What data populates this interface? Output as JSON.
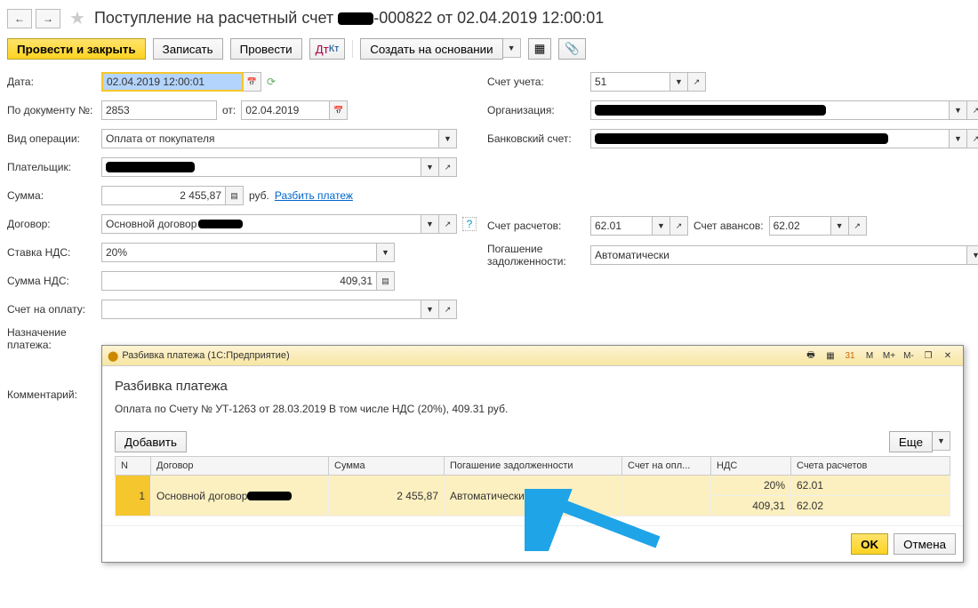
{
  "header": {
    "title_pre": "Поступление на расчетный счет",
    "title_mid": "-000822 от 02.04.2019 12:00:01"
  },
  "toolbar": {
    "post_close": "Провести и закрыть",
    "write": "Записать",
    "post": "Провести",
    "create_based": "Создать на основании"
  },
  "labels": {
    "date": "Дата:",
    "doc_no": "По документу №:",
    "by_date": "от:",
    "op_type": "Вид операции:",
    "payer": "Плательщик:",
    "sum": "Сумма:",
    "rub": "руб.",
    "split": "Разбить платеж",
    "contract": "Договор:",
    "vat_rate": "Ставка НДС:",
    "vat_sum": "Сумма НДС:",
    "invoice": "Счет на оплату:",
    "purpose": "Назначение платежа:",
    "comment": "Комментарий:",
    "account": "Счет учета:",
    "org": "Организация:",
    "bank_acc": "Банковский счет:",
    "settl_acc": "Счет расчетов:",
    "adv_acc": "Счет авансов:",
    "debt_pay": "Погашение задолженности:"
  },
  "values": {
    "date": "02.04.2019 12:00:01",
    "doc_no": "2853",
    "doc_date": "02.04.2019",
    "op_type": "Оплата от покупателя",
    "sum": "2 455,87",
    "contract": "Основной договор",
    "vat_rate": "20%",
    "vat_sum": "409,31",
    "account": "51",
    "settl_acc": "62.01",
    "adv_acc": "62.02",
    "debt_pay": "Автоматически"
  },
  "modal": {
    "wintitle": "Разбивка платежа  (1С:Предприятие)",
    "title": "Разбивка платежа",
    "desc": "Оплата по Счету № УТ-1263 от 28.03.2019 В том числе НДС (20%), 409.31 руб.",
    "add": "Добавить",
    "more": "Еще",
    "ok": "OK",
    "cancel": "Отмена",
    "dialog_icons": {
      "m": "M",
      "m_plus": "M+",
      "m_minus": "M-"
    },
    "cols": {
      "n": "N",
      "contract": "Договор",
      "sum": "Сумма",
      "debt": "Погашение задолженности",
      "inv": "Счет на опл...",
      "vat": "НДС",
      "accounts": "Счета расчетов"
    },
    "row": {
      "n": "1",
      "contract": "Основной договор",
      "sum": "2 455,87",
      "debt": "Автоматически",
      "vat_rate": "20%",
      "vat_sum": "409,31",
      "acc1": "62.01",
      "acc2": "62.02"
    }
  }
}
